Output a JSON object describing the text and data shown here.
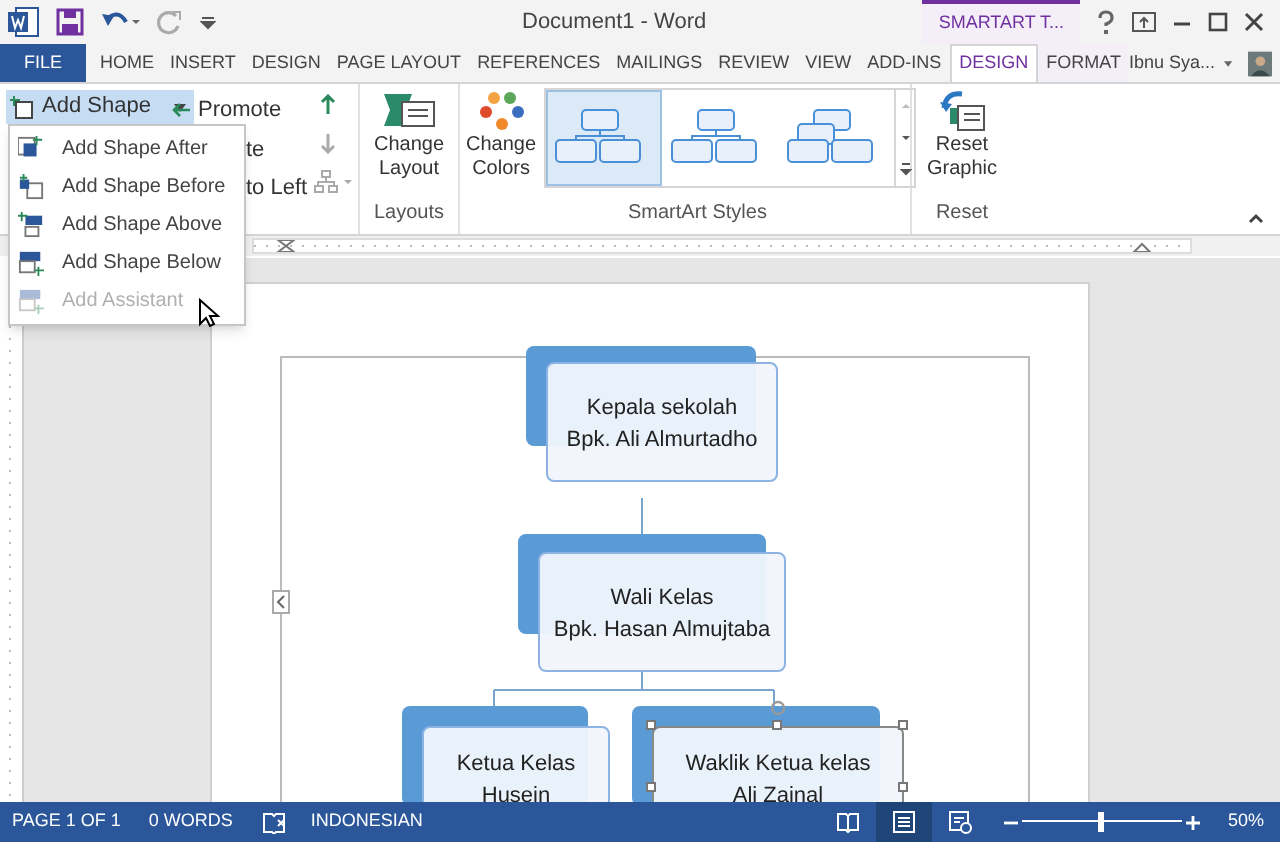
{
  "title_bar": {
    "title": "Document1 - Word",
    "contextual_tab": "SMARTART T..."
  },
  "tabs": [
    {
      "label": "FILE",
      "kind": "file",
      "selected": false
    },
    {
      "label": "HOME",
      "kind": "normal",
      "selected": false
    },
    {
      "label": "INSERT",
      "kind": "normal",
      "selected": false
    },
    {
      "label": "DESIGN",
      "kind": "normal",
      "selected": false
    },
    {
      "label": "PAGE LAYOUT",
      "kind": "normal",
      "selected": false
    },
    {
      "label": "REFERENCES",
      "kind": "normal",
      "selected": false
    },
    {
      "label": "MAILINGS",
      "kind": "normal",
      "selected": false
    },
    {
      "label": "REVIEW",
      "kind": "normal",
      "selected": false
    },
    {
      "label": "VIEW",
      "kind": "normal",
      "selected": false
    },
    {
      "label": "ADD-INS",
      "kind": "normal",
      "selected": false
    },
    {
      "label": "DESIGN",
      "kind": "contextual",
      "selected": true
    },
    {
      "label": "FORMAT",
      "kind": "contextual",
      "selected": false
    }
  ],
  "user": {
    "name": "Ibnu Sya..."
  },
  "ribbon": {
    "add_shape": "Add Shape",
    "promote": "Promote",
    "demote_partial": "te",
    "right_to_left_partial": "to Left",
    "layouts": {
      "button": "Change Layout",
      "label": "Layouts"
    },
    "styles": {
      "button": "Change Colors",
      "label": "SmartArt Styles",
      "gallery": [
        {
          "kind": "tree",
          "selected": true
        },
        {
          "kind": "tree",
          "selected": false
        },
        {
          "kind": "pyramid",
          "selected": false
        }
      ]
    },
    "reset": {
      "button": "Reset Graphic",
      "label": "Reset"
    }
  },
  "menu": {
    "items": [
      {
        "label": "Add Shape After",
        "disabled": false
      },
      {
        "label": "Add Shape Before",
        "disabled": false
      },
      {
        "label": "Add Shape Above",
        "disabled": false
      },
      {
        "label": "Add Shape Below",
        "disabled": false
      },
      {
        "label": "Add Assistant",
        "disabled": true
      }
    ]
  },
  "diagram": {
    "nodes": [
      {
        "lines": [
          "Kepala sekolah",
          "Bpk. Ali Almurtadho"
        ],
        "selected": false
      },
      {
        "lines": [
          "Wali Kelas",
          "Bpk. Hasan Almujtaba"
        ],
        "selected": false
      },
      {
        "lines": [
          "Ketua Kelas",
          "Husein"
        ],
        "selected": false
      },
      {
        "lines": [
          "Waklik Ketua kelas",
          "Ali Zainal"
        ],
        "selected": true
      }
    ]
  },
  "status_bar": {
    "page": "PAGE 1 OF 1",
    "words": "0 WORDS",
    "language": "INDONESIAN",
    "views": [
      {
        "kind": "read",
        "selected": false
      },
      {
        "kind": "print",
        "selected": true
      },
      {
        "kind": "web",
        "selected": false
      }
    ],
    "zoom": {
      "level": 0.5,
      "reading": "50%"
    }
  }
}
